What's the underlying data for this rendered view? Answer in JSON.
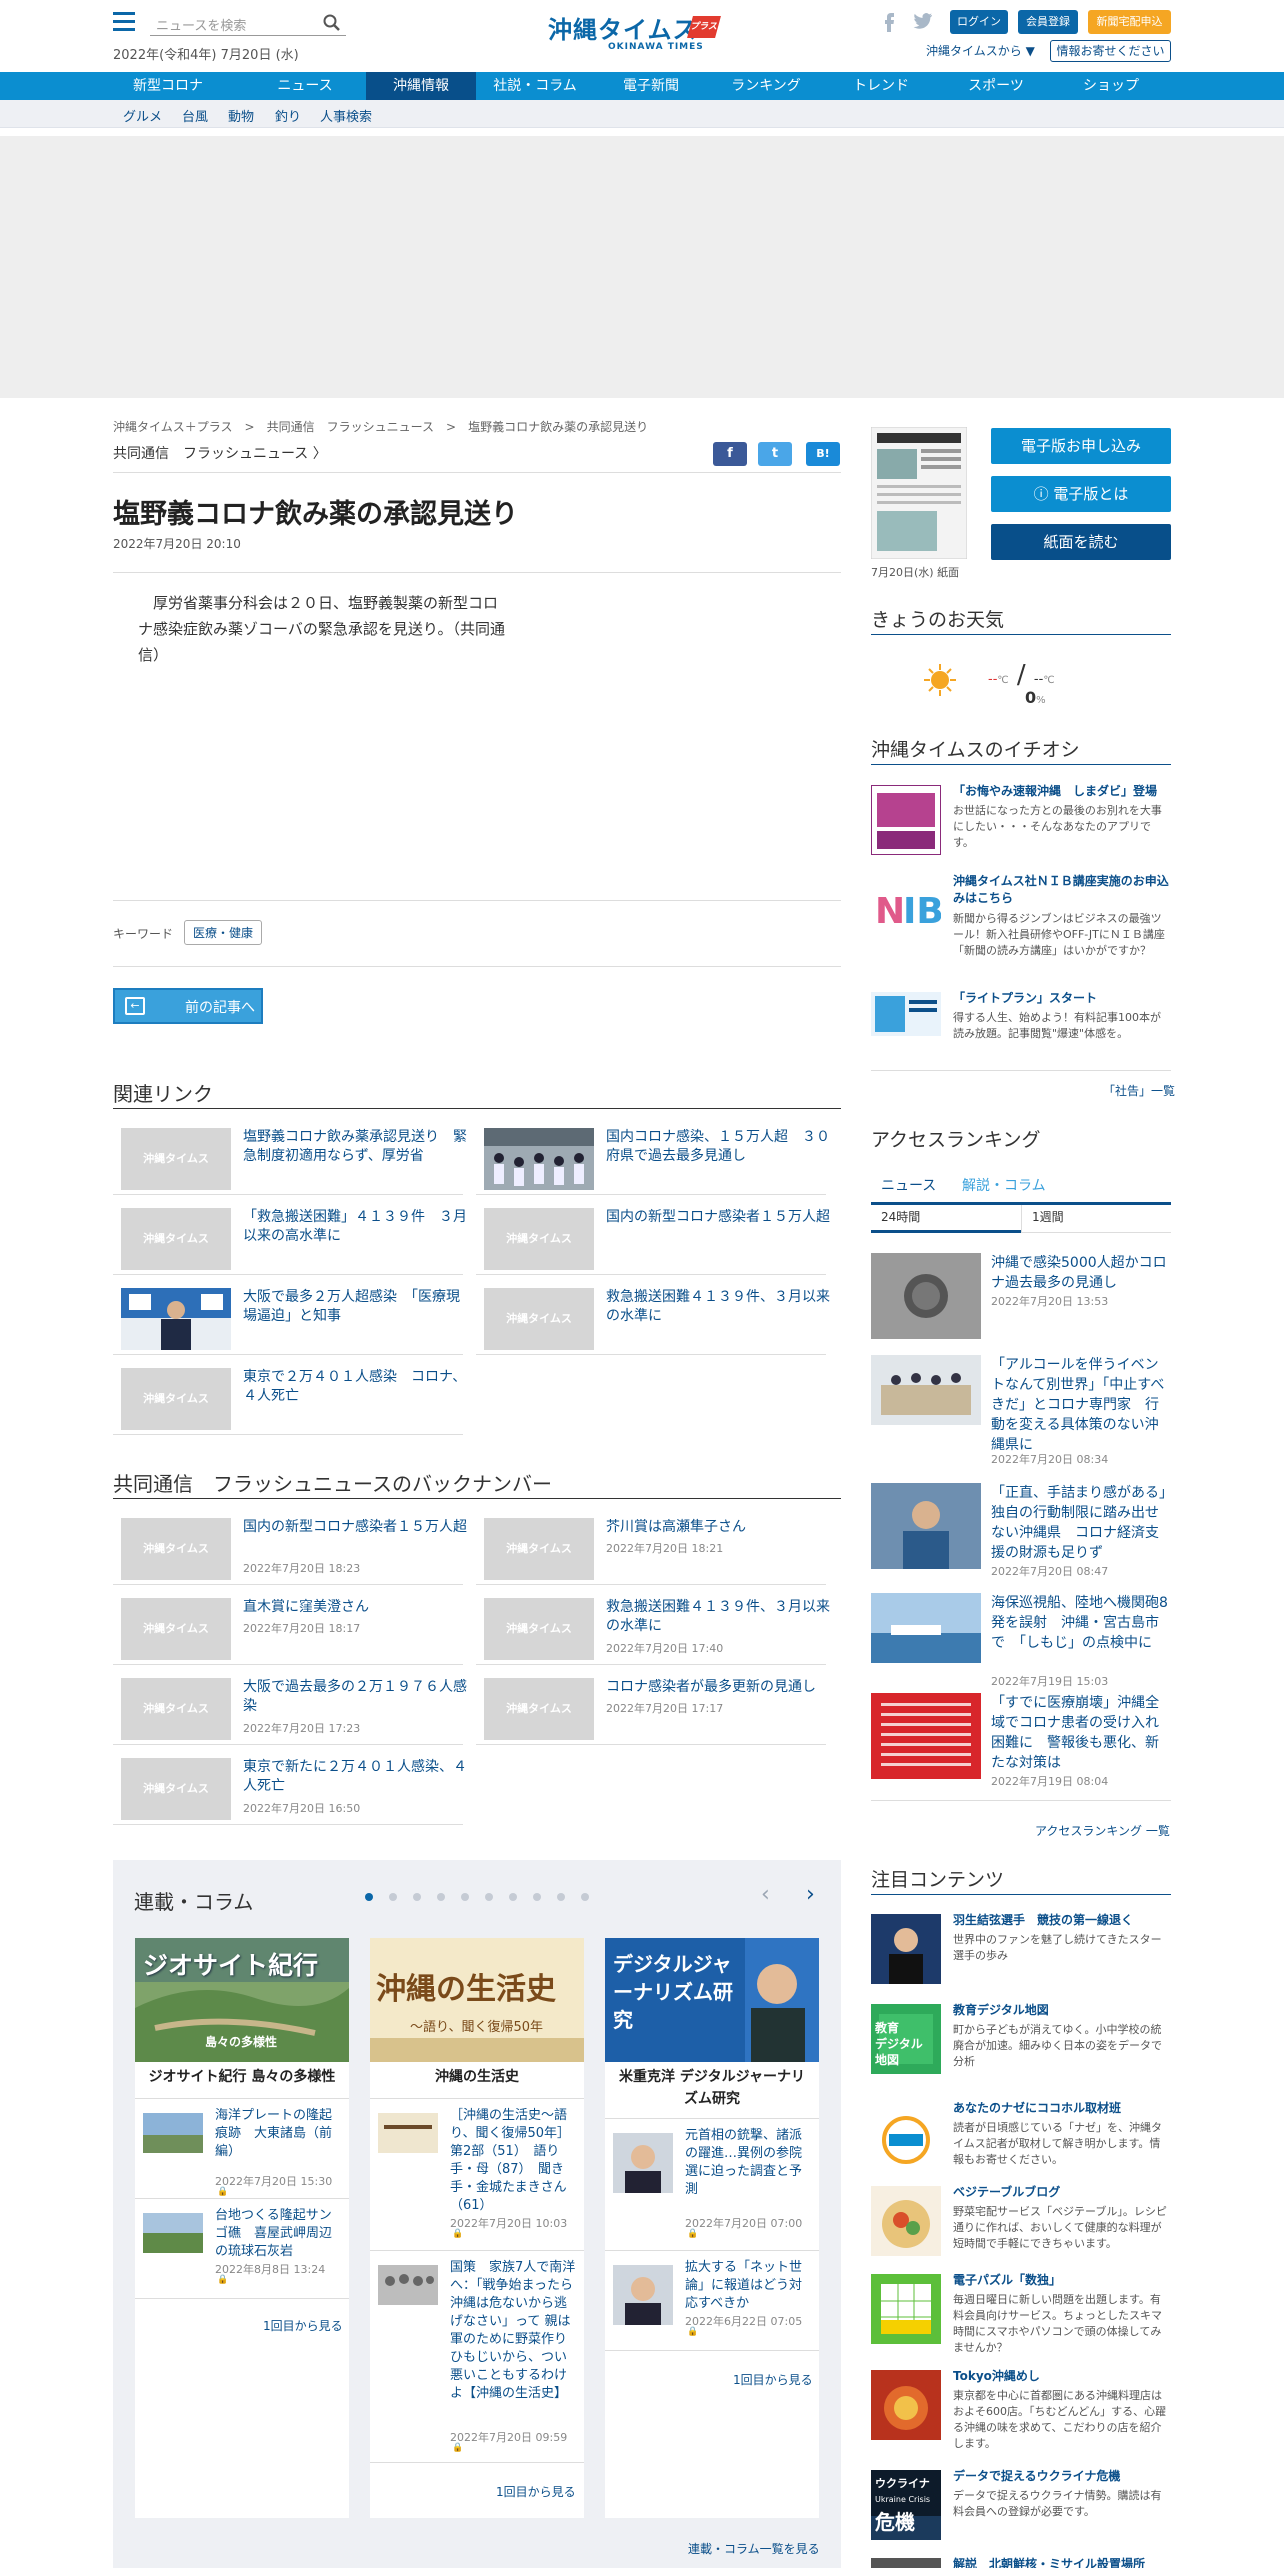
{
  "header": {
    "search_placeholder": "ニュースを検索",
    "date": "2022年(令和4年) 7月20日 (水)",
    "logo_jp": "沖縄タイムス",
    "logo_plus": "プラス",
    "logo_en": "OKINAWA TIMES",
    "login": "ログイン",
    "register": "会員登録",
    "newspaper_apply": "新聞宅配申込",
    "from_okinawa_times": "沖縄タイムスから",
    "send_info": "情報お寄せください"
  },
  "nav": {
    "items": [
      "新型コロナ",
      "ニュース",
      "沖縄情報",
      "社説・コラム",
      "電子新聞",
      "ランキング",
      "トレンド",
      "スポーツ",
      "ショップ"
    ],
    "sub": [
      "グルメ",
      "台風",
      "動物",
      "釣り",
      "人事検索"
    ]
  },
  "breadcrumb": [
    "沖縄タイムス＋プラス",
    "共同通信　フラッシュニュース",
    "塩野義コロナ飲み薬の承認見送り"
  ],
  "article": {
    "category": "共同通信　フラッシュニュース",
    "title": "塩野義コロナ飲み薬の承認見送り",
    "date": "2022年7月20日 20:10",
    "body": "厚労省薬事分科会は２０日、塩野義製薬の新型コロナ感染症飲み薬ゾコーバの緊急承認を見送り。（共同通信）",
    "keyword_label": "キーワード",
    "keyword": "医療・健康",
    "prev_button": "前の記事へ",
    "share": [
      "f",
      "t",
      "B!"
    ]
  },
  "related": {
    "heading": "関連リンク",
    "items": [
      {
        "title": "塩野義コロナ飲み薬承認見送り　緊急制度初適用ならず、厚労省",
        "thumb": "沖縄タイムス"
      },
      {
        "title": "国内コロナ感染、１５万人超　３０府県で過去最多見通し",
        "thumb": ""
      },
      {
        "title": "「救急搬送困難」４１３９件　３月以来の高水準に",
        "thumb": "沖縄タイムス"
      },
      {
        "title": "国内の新型コロナ感染者１５万人超",
        "thumb": "沖縄タイムス"
      },
      {
        "title": "大阪で最多２万人超感染　「医療現場逼迫」と知事",
        "thumb": ""
      },
      {
        "title": "救急搬送困難４１３９件、３月以来の水準に",
        "thumb": "沖縄タイムス"
      },
      {
        "title": "東京で２万４０１人感染　コロナ、４人死亡",
        "thumb": "沖縄タイムス"
      }
    ]
  },
  "backnumber": {
    "heading": "共同通信　フラッシュニュースのバックナンバー",
    "items": [
      {
        "title": "国内の新型コロナ感染者１５万人超",
        "date": "2022年7月20日 18:23",
        "thumb": "沖縄タイムス"
      },
      {
        "title": "芥川賞は高瀬隼子さん",
        "date": "2022年7月20日 18:21",
        "thumb": "沖縄タイムス"
      },
      {
        "title": "直木賞に窪美澄さん",
        "date": "2022年7月20日 18:17",
        "thumb": "沖縄タイムス"
      },
      {
        "title": "救急搬送困難４１３９件、３月以来の水準に",
        "date": "2022年7月20日 17:40",
        "thumb": "沖縄タイムス"
      },
      {
        "title": "大阪で過去最多の２万１９７６人感染",
        "date": "2022年7月20日 17:23",
        "thumb": "沖縄タイムス"
      },
      {
        "title": "コロナ感染者が最多更新の見通し",
        "date": "2022年7月20日 17:17",
        "thumb": "沖縄タイムス"
      },
      {
        "title": "東京で新たに２万４０１人感染、４人死亡",
        "date": "2022年7月20日 16:50",
        "thumb": "沖縄タイムス"
      }
    ]
  },
  "columns": {
    "heading": "連載・コラム",
    "dots": 10,
    "more_all": "連載・コラム一覧を見る",
    "cards": [
      {
        "banner": "ジオサイト紀行",
        "banner_sub": "島々の多様性",
        "name": "ジオサイト紀行 島々の多様性",
        "items": [
          {
            "title": "海洋プレートの隆起痕跡　大東諸島（前編）",
            "date": "2022年7月20日 15:30"
          },
          {
            "title": "台地つくる隆起サンゴ礁　喜屋武岬周辺の琉球石灰岩",
            "date": "2022年8月8日 13:24"
          }
        ],
        "more": "1回目から見る"
      },
      {
        "banner": "沖縄の生活史",
        "banner_sub": "〜語り、聞く復帰50年",
        "name": "沖縄の生活史",
        "items": [
          {
            "title": "［沖縄の生活史〜語り、聞く復帰50年］第2部（51）　語り手・母（87）　聞き手・金城たまきさん（61）",
            "date": "2022年7月20日 10:03"
          },
          {
            "title": "国策　家族7人で南洋へ：「戦争始まったら沖縄は危ないから逃げなさい」って 親は軍のために野菜作り　ひもじいから、つい悪いこともするわけよ【沖縄の生活史】",
            "date": "2022年7月20日 09:59"
          }
        ],
        "more": "1回目から見る"
      },
      {
        "banner": "デジタルジャーナリズム研究",
        "banner_sub": "",
        "name": "米重克洋 デジタルジャーナリズム研究",
        "items": [
          {
            "title": "元首相の銃撃、諸派の躍進…異例の参院選に迫った調査と予測",
            "date": "2022年7月20日 07:00"
          },
          {
            "title": "拡大する「ネット世論」に報道はどう対応すべきか",
            "date": "2022年6月22日 07:05"
          }
        ],
        "more": "1回目から見る"
      }
    ]
  },
  "sidebar": {
    "paper_date": "7月20日(水) 紙面",
    "btn_apply": "電子版お申し込み",
    "btn_about": "電子版とは",
    "btn_read": "紙面を読む",
    "weather_heading": "きょうのお天気",
    "temp_high": "--",
    "temp_low": "--",
    "temp_unit": "℃",
    "precip": "0",
    "precip_unit": "%",
    "ichioshi_heading": "沖縄タイムスのイチオシ",
    "ichioshi": [
      {
        "title": "「お悔やみ速報沖縄　しまダビ」登場",
        "desc": "お世話になった方との最後のお別れを大事にしたい・・・そんなあなたのアプリです。"
      },
      {
        "title": "沖縄タイムス社ＮＩＢ講座実施のお申込みはこちら",
        "desc": "新聞から得るジンブンはビジネスの最強ツール！新入社員研修やOFF-JTにＮＩＢ講座「新聞の読み方講座」はいかがですか？"
      },
      {
        "title": "「ライトプラン」スタート",
        "desc": "得する人生、始めよう！有料記事100本が読み放題。記事閲覧\"爆速\"体感を。"
      }
    ],
    "ichioshi_more": "「社告」一覧",
    "ranking_heading": "アクセスランキング",
    "ranking_tabs": [
      "ニュース",
      "解説・コラム"
    ],
    "ranking_periods": [
      "24時間",
      "1週間"
    ],
    "ranking": [
      {
        "title": "沖縄で感染5000人超かコロナ過去最多の見通し",
        "date": "2022年7月20日 13:53"
      },
      {
        "title": "「アルコールを伴うイベントなんて別世界」「中止すべきだ」とコロナ専門家　行動を変える具体策のない沖縄県に",
        "date": "2022年7月20日 08:34"
      },
      {
        "title": "「正直、手詰まり感がある」独自の行動制限に踏み出せない沖縄県　コロナ経済支援の財源も足りず",
        "date": "2022年7月20日 08:47"
      },
      {
        "title": "海保巡視船、陸地へ機関砲8発を誤射　沖縄・宮古島市で　「しもじ」の点検中に",
        "date": "2022年7月19日 15:03"
      },
      {
        "title": "「すでに医療崩壊」沖縄全域でコロナ患者の受け入れ困難に　警報後も悪化、新たな対策は",
        "date": "2022年7月19日 08:04"
      }
    ],
    "ranking_more": "アクセスランキング 一覧",
    "attention_heading": "注目コンテンツ",
    "attention": [
      {
        "title": "羽生結弦選手　競技の第一線退く",
        "desc": "世界中のファンを魅了し続けてきたスター選手の歩み"
      },
      {
        "title": "教育デジタル地図",
        "desc": "町から子どもが消えてゆく。小中学校の統廃合が加速。細みゆく日本の姿をデータで分析"
      },
      {
        "title": "あなたのナゼにココホル取材班",
        "desc": "読者が日頃感じている「ナゼ」を、沖縄タイムス記者が取材して解き明かします。情報もお寄せください。"
      },
      {
        "title": "ベジテーブルブログ",
        "desc": "野菜宅配サービス「ベジテーブル」。レシピ通りに作れば、おいしくて健康的な料理が短時間で手軽にできちゃいます。"
      },
      {
        "title": "電子パズル「数独」",
        "desc": "毎週日曜日に新しい問題を出題します。有料会員向けサービス。ちょっとしたスキマ時間にスマホやパソコンで頭の体操してみませんか？"
      },
      {
        "title": "Tokyo沖縄めし",
        "desc": "東京都を中心に首都圏にある沖縄料理店はおよそ600店。「ちむどんどん」する、心躍る沖縄の味を求めて、こだわりの店を紹介します。"
      },
      {
        "title": "データで捉えるウクライナ危機",
        "desc": "データで捉えるウクライナ情勢。購読は有料会員への登録が必要です。"
      },
      {
        "title": "解説　北朝鮮核・ミサイル設置場所",
        "desc": ""
      }
    ]
  },
  "colors": {
    "brand": "#0b67a8",
    "nav": "#0b8ed0",
    "nav_active": "#084f8a",
    "accent": "#f5a623"
  }
}
